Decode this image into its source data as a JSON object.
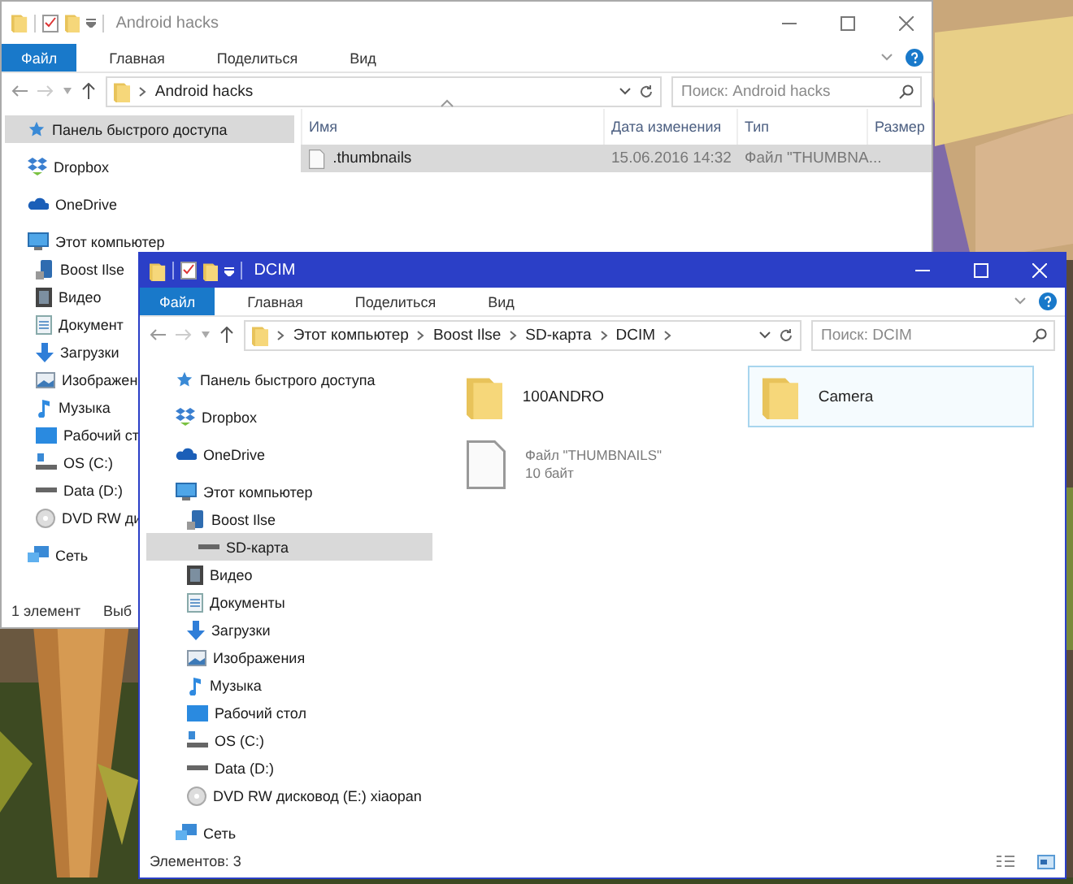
{
  "windows": [
    {
      "title": "Android hacks",
      "active": false,
      "ribbon_tabs": [
        {
          "label": "Файл",
          "kind": "file"
        },
        {
          "label": "Главная",
          "kind": "tab"
        },
        {
          "label": "Поделиться",
          "kind": "tab"
        },
        {
          "label": "Вид",
          "kind": "tab"
        }
      ],
      "address": [
        "Android hacks"
      ],
      "trailing_chevron": false,
      "search": {
        "placeholder": "Поиск: Android hacks"
      },
      "nav": [
        {
          "label": "Панель быстрого доступа",
          "kind": "quick",
          "selected": true
        },
        {
          "label": "Dropbox",
          "kind": "dropbox",
          "selected": false
        },
        {
          "label": "OneDrive",
          "kind": "onedrive",
          "selected": false
        },
        {
          "label": "Этот компьютер",
          "kind": "pc",
          "selected": false,
          "children": [
            {
              "label": "Boost Ilse",
              "kind": "phone",
              "selected": false
            },
            {
              "label": "Видео",
              "kind": "video",
              "selected": false
            },
            {
              "label": "Документ",
              "kind": "docs",
              "selected": false
            },
            {
              "label": "Загрузки",
              "kind": "downloads",
              "selected": false
            },
            {
              "label": "Изображен",
              "kind": "images",
              "selected": false
            },
            {
              "label": "Музыка",
              "kind": "music",
              "selected": false
            },
            {
              "label": "Рабочий ст",
              "kind": "desktop",
              "selected": false
            },
            {
              "label": "OS (C:)",
              "kind": "osdrive",
              "selected": false
            },
            {
              "label": "Data (D:)",
              "kind": "drive",
              "selected": false
            },
            {
              "label": "DVD RW ди",
              "kind": "dvd",
              "selected": false
            }
          ]
        },
        {
          "label": "Сеть",
          "kind": "network",
          "selected": false
        }
      ],
      "columns": [
        "Имя",
        "Дата изменения",
        "Тип",
        "Размер"
      ],
      "rows": [
        {
          "cells": [
            ".thumbnails",
            "15.06.2016 14:32",
            "Файл \"THUMBNA..."
          ],
          "selected": true
        }
      ],
      "status": [
        "1 элемент",
        "Выб"
      ]
    },
    {
      "title": "DCIM",
      "active": true,
      "ribbon_tabs": [
        {
          "label": "Файл",
          "kind": "file"
        },
        {
          "label": "Главная",
          "kind": "tab"
        },
        {
          "label": "Поделиться",
          "kind": "tab"
        },
        {
          "label": "Вид",
          "kind": "tab"
        }
      ],
      "address": [
        "Этот компьютер",
        "Boost Ilse",
        "SD-карта",
        "DCIM"
      ],
      "trailing_chevron": true,
      "search": {
        "placeholder": "Поиск: DCIM"
      },
      "nav": [
        {
          "label": "Панель быстрого доступа",
          "kind": "quick",
          "selected": false
        },
        {
          "label": "Dropbox",
          "kind": "dropbox",
          "selected": false
        },
        {
          "label": "OneDrive",
          "kind": "onedrive",
          "selected": false
        },
        {
          "label": "Этот компьютер",
          "kind": "pc",
          "selected": false,
          "children": [
            {
              "label": "Boost Ilse",
              "kind": "phone",
              "selected": false,
              "children": [
                {
                  "label": "SD-карта",
                  "kind": "drive",
                  "selected": true
                }
              ]
            },
            {
              "label": "Видео",
              "kind": "video",
              "selected": false
            },
            {
              "label": "Документы",
              "kind": "docs",
              "selected": false
            },
            {
              "label": "Загрузки",
              "kind": "downloads",
              "selected": false
            },
            {
              "label": "Изображения",
              "kind": "images",
              "selected": false
            },
            {
              "label": "Музыка",
              "kind": "music",
              "selected": false
            },
            {
              "label": "Рабочий стол",
              "kind": "desktop",
              "selected": false
            },
            {
              "label": "OS (C:)",
              "kind": "osdrive",
              "selected": false
            },
            {
              "label": "Data (D:)",
              "kind": "drive",
              "selected": false
            },
            {
              "label": "DVD RW дисковод (E:) xiaopan",
              "kind": "dvd",
              "selected": false
            }
          ]
        },
        {
          "label": "Сеть",
          "kind": "network",
          "selected": false
        }
      ],
      "items": [
        {
          "kind": "folder",
          "name": "100ANDRO",
          "selected": false
        },
        {
          "kind": "folder",
          "name": "Camera",
          "selected": true
        },
        {
          "kind": "file",
          "lines": [
            "Файл \"THUMBNAILS\"",
            "10 байт"
          ],
          "selected": false
        }
      ],
      "status": [
        "Элементов: 3"
      ]
    }
  ]
}
